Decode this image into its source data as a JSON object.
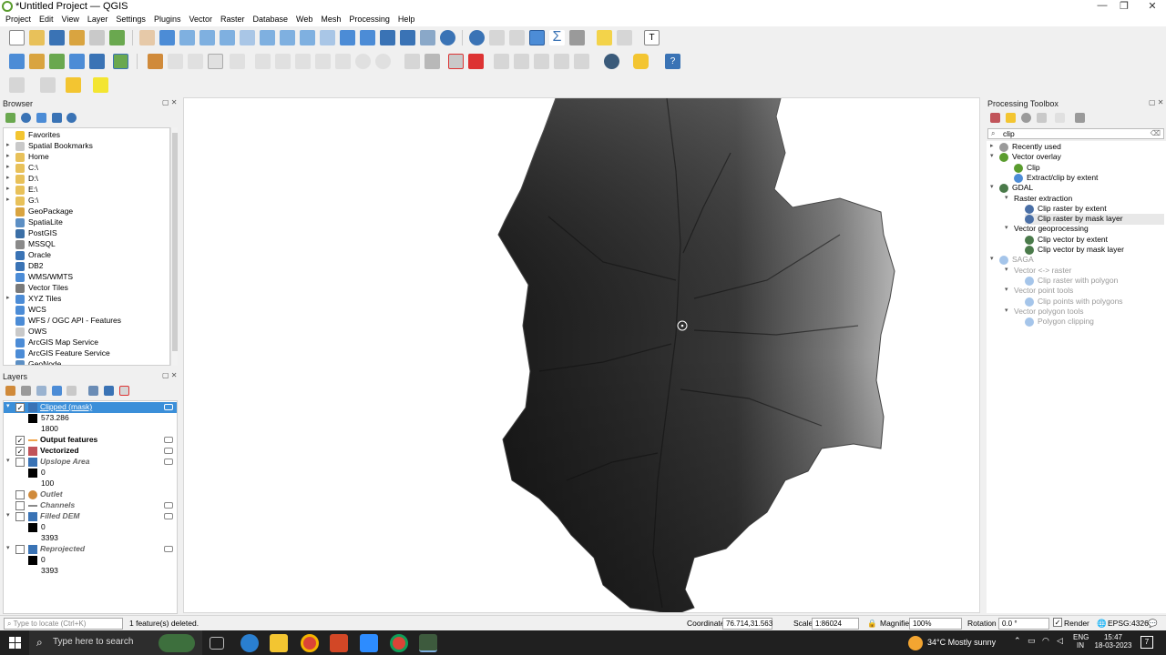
{
  "window": {
    "title": "*Untitled Project — QGIS"
  },
  "menu": [
    "Project",
    "Edit",
    "View",
    "Layer",
    "Settings",
    "Plugins",
    "Vector",
    "Raster",
    "Database",
    "Web",
    "Mesh",
    "Processing",
    "Help"
  ],
  "browser": {
    "title": "Browser",
    "items": [
      {
        "label": "Favorites",
        "arrow": "",
        "icon": "star-icon",
        "color": "#f3c531"
      },
      {
        "label": "Spatial Bookmarks",
        "arrow": "▸",
        "icon": "bookmark-icon",
        "color": "#c9c9c9"
      },
      {
        "label": "Home",
        "arrow": "▸",
        "icon": "folder-icon",
        "color": "#e8c15a"
      },
      {
        "label": "C:\\",
        "arrow": "▸",
        "icon": "drive-icon",
        "color": "#e8c15a"
      },
      {
        "label": "D:\\",
        "arrow": "▸",
        "icon": "drive-icon",
        "color": "#e8c15a"
      },
      {
        "label": "E:\\",
        "arrow": "▸",
        "icon": "drive-icon",
        "color": "#e8c15a"
      },
      {
        "label": "G:\\",
        "arrow": "▸",
        "icon": "drive-icon",
        "color": "#e8c15a"
      },
      {
        "label": "GeoPackage",
        "arrow": "",
        "icon": "geopackage-icon",
        "color": "#d9a440"
      },
      {
        "label": "SpatiaLite",
        "arrow": "",
        "icon": "spatialite-icon",
        "color": "#5c8fc4"
      },
      {
        "label": "PostGIS",
        "arrow": "",
        "icon": "postgis-icon",
        "color": "#3b6fa6"
      },
      {
        "label": "MSSQL",
        "arrow": "",
        "icon": "mssql-icon",
        "color": "#8a8a8a"
      },
      {
        "label": "Oracle",
        "arrow": "",
        "icon": "oracle-icon",
        "color": "#3a73b5"
      },
      {
        "label": "DB2",
        "arrow": "",
        "icon": "db2-icon",
        "color": "#3a73b5"
      },
      {
        "label": "WMS/WMTS",
        "arrow": "",
        "icon": "wms-icon",
        "color": "#4c8cd6"
      },
      {
        "label": "Vector Tiles",
        "arrow": "",
        "icon": "vector-tiles-icon",
        "color": "#7a7a7a"
      },
      {
        "label": "XYZ Tiles",
        "arrow": "▸",
        "icon": "xyz-tiles-icon",
        "color": "#4c8cd6"
      },
      {
        "label": "WCS",
        "arrow": "",
        "icon": "wcs-icon",
        "color": "#4c8cd6"
      },
      {
        "label": "WFS / OGC API - Features",
        "arrow": "",
        "icon": "wfs-icon",
        "color": "#4c8cd6"
      },
      {
        "label": "OWS",
        "arrow": "",
        "icon": "ows-icon",
        "color": "#c9c9c9"
      },
      {
        "label": "ArcGIS Map Service",
        "arrow": "",
        "icon": "arcgis-map-icon",
        "color": "#4c8cd6"
      },
      {
        "label": "ArcGIS Feature Service",
        "arrow": "",
        "icon": "arcgis-feature-icon",
        "color": "#4c8cd6"
      },
      {
        "label": "GeoNode",
        "arrow": "",
        "icon": "geonode-icon",
        "color": "#5c8fc4"
      }
    ]
  },
  "layers": {
    "title": "Layers",
    "items": [
      {
        "type": "layer",
        "label": "Clipped (mask)",
        "checked": true,
        "selected": true,
        "bold": false,
        "italic": false,
        "arrow": "▾",
        "icon": "raster-icon",
        "icon_color": "#3a73b5",
        "eye": true
      },
      {
        "type": "legend",
        "label": "573.286"
      },
      {
        "type": "legend",
        "label": "1800"
      },
      {
        "type": "layer",
        "label": "Output features",
        "checked": true,
        "selected": false,
        "bold": true,
        "italic": false,
        "arrow": "",
        "icon": "line-icon",
        "icon_color": "#f0a44a",
        "eye": true
      },
      {
        "type": "layer",
        "label": "Vectorized",
        "checked": true,
        "selected": false,
        "bold": true,
        "italic": false,
        "arrow": "",
        "icon": "polygon-icon",
        "icon_color": "#c1545a",
        "eye": true
      },
      {
        "type": "layer",
        "label": "Upslope Area",
        "checked": false,
        "selected": false,
        "bold": true,
        "italic": true,
        "arrow": "▾",
        "icon": "raster-icon",
        "icon_color": "#3a73b5",
        "eye": true
      },
      {
        "type": "legend",
        "label": "0"
      },
      {
        "type": "legend",
        "label": "100"
      },
      {
        "type": "layer",
        "label": "Outlet",
        "checked": false,
        "selected": false,
        "bold": true,
        "italic": true,
        "arrow": "",
        "icon": "point-icon",
        "icon_color": "#d08a3a",
        "eye": false
      },
      {
        "type": "layer",
        "label": "Channels",
        "checked": false,
        "selected": false,
        "bold": true,
        "italic": true,
        "arrow": "",
        "icon": "line-icon",
        "icon_color": "#8a8a8a",
        "eye": true
      },
      {
        "type": "layer",
        "label": "Filled DEM",
        "checked": false,
        "selected": false,
        "bold": true,
        "italic": true,
        "arrow": "▾",
        "icon": "raster-icon",
        "icon_color": "#3a73b5",
        "eye": true
      },
      {
        "type": "legend",
        "label": "0"
      },
      {
        "type": "legend",
        "label": "3393"
      },
      {
        "type": "layer",
        "label": "Reprojected",
        "checked": false,
        "selected": false,
        "bold": true,
        "italic": true,
        "arrow": "▾",
        "icon": "raster-icon",
        "icon_color": "#3a73b5",
        "eye": true
      },
      {
        "type": "legend",
        "label": "0"
      },
      {
        "type": "legend",
        "label": "3393"
      }
    ]
  },
  "processing": {
    "title": "Processing Toolbox",
    "search_value": "clip",
    "items": [
      {
        "label": "Recently used",
        "level": 0,
        "arrow": "▸",
        "icon": "clock-icon",
        "color": "#9a9a9a",
        "dim": false,
        "selected": false
      },
      {
        "label": "Vector overlay",
        "level": 0,
        "arrow": "▾",
        "icon": "qgis-icon",
        "color": "#5a9c2e",
        "dim": false,
        "selected": false
      },
      {
        "label": "Clip",
        "level": 1,
        "arrow": "",
        "icon": "qgis-algorithm-icon",
        "color": "#5a9c2e",
        "dim": false,
        "selected": false
      },
      {
        "label": "Extract/clip by extent",
        "level": 1,
        "arrow": "",
        "icon": "gear-icon",
        "color": "#4c8cd6",
        "dim": false,
        "selected": false
      },
      {
        "label": "GDAL",
        "level": 0,
        "arrow": "▾",
        "icon": "gdal-icon",
        "color": "#4a7a4a",
        "dim": false,
        "selected": false
      },
      {
        "label": "Raster extraction",
        "level": 1,
        "arrow": "▾",
        "icon": "",
        "color": "",
        "dim": false,
        "selected": false
      },
      {
        "label": "Clip raster by extent",
        "level": 2,
        "arrow": "",
        "icon": "gdal-raster-icon",
        "color": "#4a6fa6",
        "dim": false,
        "selected": false
      },
      {
        "label": "Clip raster by mask layer",
        "level": 2,
        "arrow": "",
        "icon": "gdal-raster-icon",
        "color": "#4a6fa6",
        "dim": false,
        "selected": true
      },
      {
        "label": "Vector geoprocessing",
        "level": 1,
        "arrow": "▾",
        "icon": "",
        "color": "",
        "dim": false,
        "selected": false
      },
      {
        "label": "Clip vector by extent",
        "level": 2,
        "arrow": "",
        "icon": "gdal-vector-icon",
        "color": "#4a7a4a",
        "dim": false,
        "selected": false
      },
      {
        "label": "Clip vector by mask layer",
        "level": 2,
        "arrow": "",
        "icon": "gdal-vector-icon",
        "color": "#4a7a4a",
        "dim": false,
        "selected": false
      },
      {
        "label": "SAGA",
        "level": 0,
        "arrow": "▾",
        "icon": "saga-icon",
        "color": "#4c8cd6",
        "dim": true,
        "selected": false
      },
      {
        "label": "Vector <-> raster",
        "level": 1,
        "arrow": "▾",
        "icon": "",
        "color": "",
        "dim": true,
        "selected": false
      },
      {
        "label": "Clip raster with polygon",
        "level": 2,
        "arrow": "",
        "icon": "saga-icon",
        "color": "#4c8cd6",
        "dim": true,
        "selected": false
      },
      {
        "label": "Vector point tools",
        "level": 1,
        "arrow": "▾",
        "icon": "",
        "color": "",
        "dim": true,
        "selected": false
      },
      {
        "label": "Clip points with polygons",
        "level": 2,
        "arrow": "",
        "icon": "saga-icon",
        "color": "#4c8cd6",
        "dim": true,
        "selected": false
      },
      {
        "label": "Vector polygon tools",
        "level": 1,
        "arrow": "▾",
        "icon": "",
        "color": "",
        "dim": true,
        "selected": false
      },
      {
        "label": "Polygon clipping",
        "level": 2,
        "arrow": "",
        "icon": "saga-icon",
        "color": "#4c8cd6",
        "dim": true,
        "selected": false
      }
    ]
  },
  "status": {
    "locate_placeholder": "Type to locate (Ctrl+K)",
    "message": "1 feature(s) deleted.",
    "coordinate_label": "Coordinate",
    "coordinate_value": "76.714,31.563",
    "scale_label": "Scale",
    "scale_value": "1:86024",
    "magnifier_label": "Magnifier",
    "magnifier_value": "100%",
    "rotation_label": "Rotation",
    "rotation_value": "0.0 °",
    "render_label": "Render",
    "crs_label": "EPSG:4326"
  },
  "taskbar": {
    "search_placeholder": "Type here to search",
    "weather": "34°C  Mostly sunny",
    "lang_1": "ENG",
    "lang_2": "IN",
    "time": "15:47",
    "date": "18-03-2023",
    "notif_count": "7"
  },
  "colors": {
    "selection": "#3b8fd9",
    "accent_green": "#5a9c2e"
  }
}
